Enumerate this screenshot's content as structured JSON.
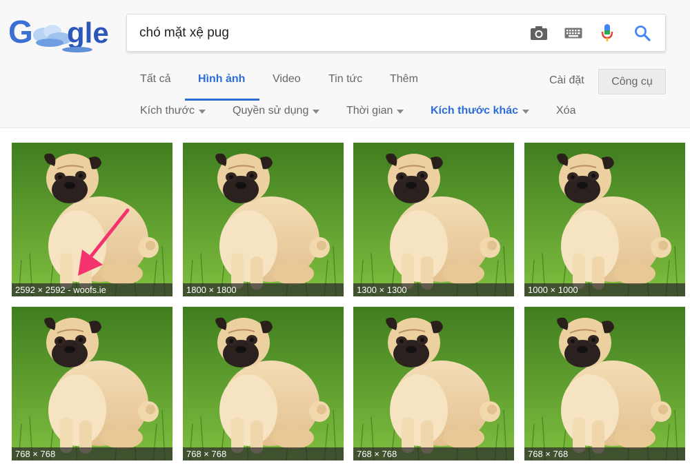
{
  "search": {
    "query": "chó mặt xệ pug"
  },
  "icons": {
    "camera": "camera-icon",
    "keyboard": "keyboard-icon",
    "mic": "microphone-icon",
    "search": "search-icon"
  },
  "tabs": [
    {
      "label": "Tất cả"
    },
    {
      "label": "Hình ảnh"
    },
    {
      "label": "Video"
    },
    {
      "label": "Tin tức"
    },
    {
      "label": "Thêm"
    }
  ],
  "settings_label": "Cài đặt",
  "tools_label": "Công cụ",
  "filters": [
    {
      "label": "Kích thước"
    },
    {
      "label": "Quyền sử dụng"
    },
    {
      "label": "Thời gian"
    },
    {
      "label": "Kích thước khác"
    },
    {
      "label": "Xóa"
    }
  ],
  "results": [
    {
      "caption": "2592 × 2592 - woofs.ie"
    },
    {
      "caption": "1800 × 1800"
    },
    {
      "caption": "1300 × 1300"
    },
    {
      "caption": "1000 × 1000"
    },
    {
      "caption": "768 × 768"
    },
    {
      "caption": "768 × 768"
    },
    {
      "caption": "768 × 768"
    },
    {
      "caption": "768 × 768"
    }
  ],
  "colors": {
    "accent": "#2b6cd6",
    "arrow": "#f4326e",
    "grass": "#5e9e2f"
  }
}
